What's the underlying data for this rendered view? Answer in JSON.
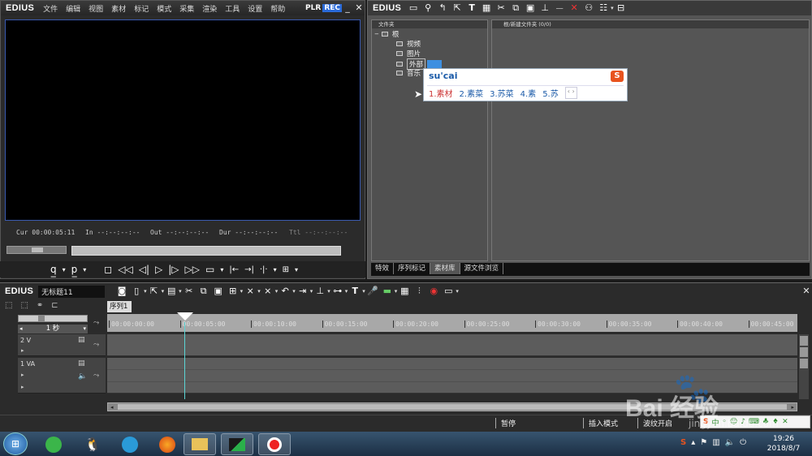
{
  "player": {
    "logo": "EDIUS",
    "menu": [
      "文件",
      "编辑",
      "视图",
      "素材",
      "标记",
      "模式",
      "采集",
      "渲染",
      "工具",
      "设置",
      "帮助"
    ],
    "plr": "PLR",
    "rec": "REC",
    "cur_label": "Cur",
    "cur_value": "00:00:05:11",
    "in_label": "In",
    "in_value": "--:--:--:--",
    "out_label": "Out",
    "out_value": "--:--:--:--",
    "dur_label": "Dur",
    "dur_value": "--:--:--:--",
    "ttl_label": "Ttl",
    "ttl_value": "--:--:--:--"
  },
  "bin": {
    "folder_header": "文件夹",
    "content_header": "根/新建文件夹 (0/0)",
    "tree": {
      "root": "根",
      "children": [
        "视频",
        "图片",
        "外部",
        "音乐"
      ]
    },
    "tabs": [
      "特效",
      "序列标记",
      "素材库",
      "源文件浏览"
    ]
  },
  "ime": {
    "input": "su'cai",
    "candidates": [
      "1.素材",
      "2.素菜",
      "3.苏菜",
      "4.素",
      "5.苏"
    ]
  },
  "timeline": {
    "logo": "EDIUS",
    "project_name": "无标题11",
    "sequence_tab": "序列1",
    "scale": "1 秒",
    "ruler": [
      "00:00:00:00",
      "00:00:05:00",
      "00:00:10:00",
      "00:00:15:00",
      "00:00:20:00",
      "00:00:25:00",
      "00:00:30:00",
      "00:00:35:00",
      "00:00:40:00",
      "00:00:45:00"
    ],
    "tracks": [
      {
        "name": "2 V"
      },
      {
        "name": "1 VA"
      }
    ],
    "status": [
      "暂停",
      "插入模式",
      "波纹开启"
    ]
  },
  "watermark": {
    "brand": "Bai 经验",
    "url": "jingyan.baidu.com"
  },
  "taskbar": {
    "time": "19:26",
    "date": "2018/8/7"
  }
}
